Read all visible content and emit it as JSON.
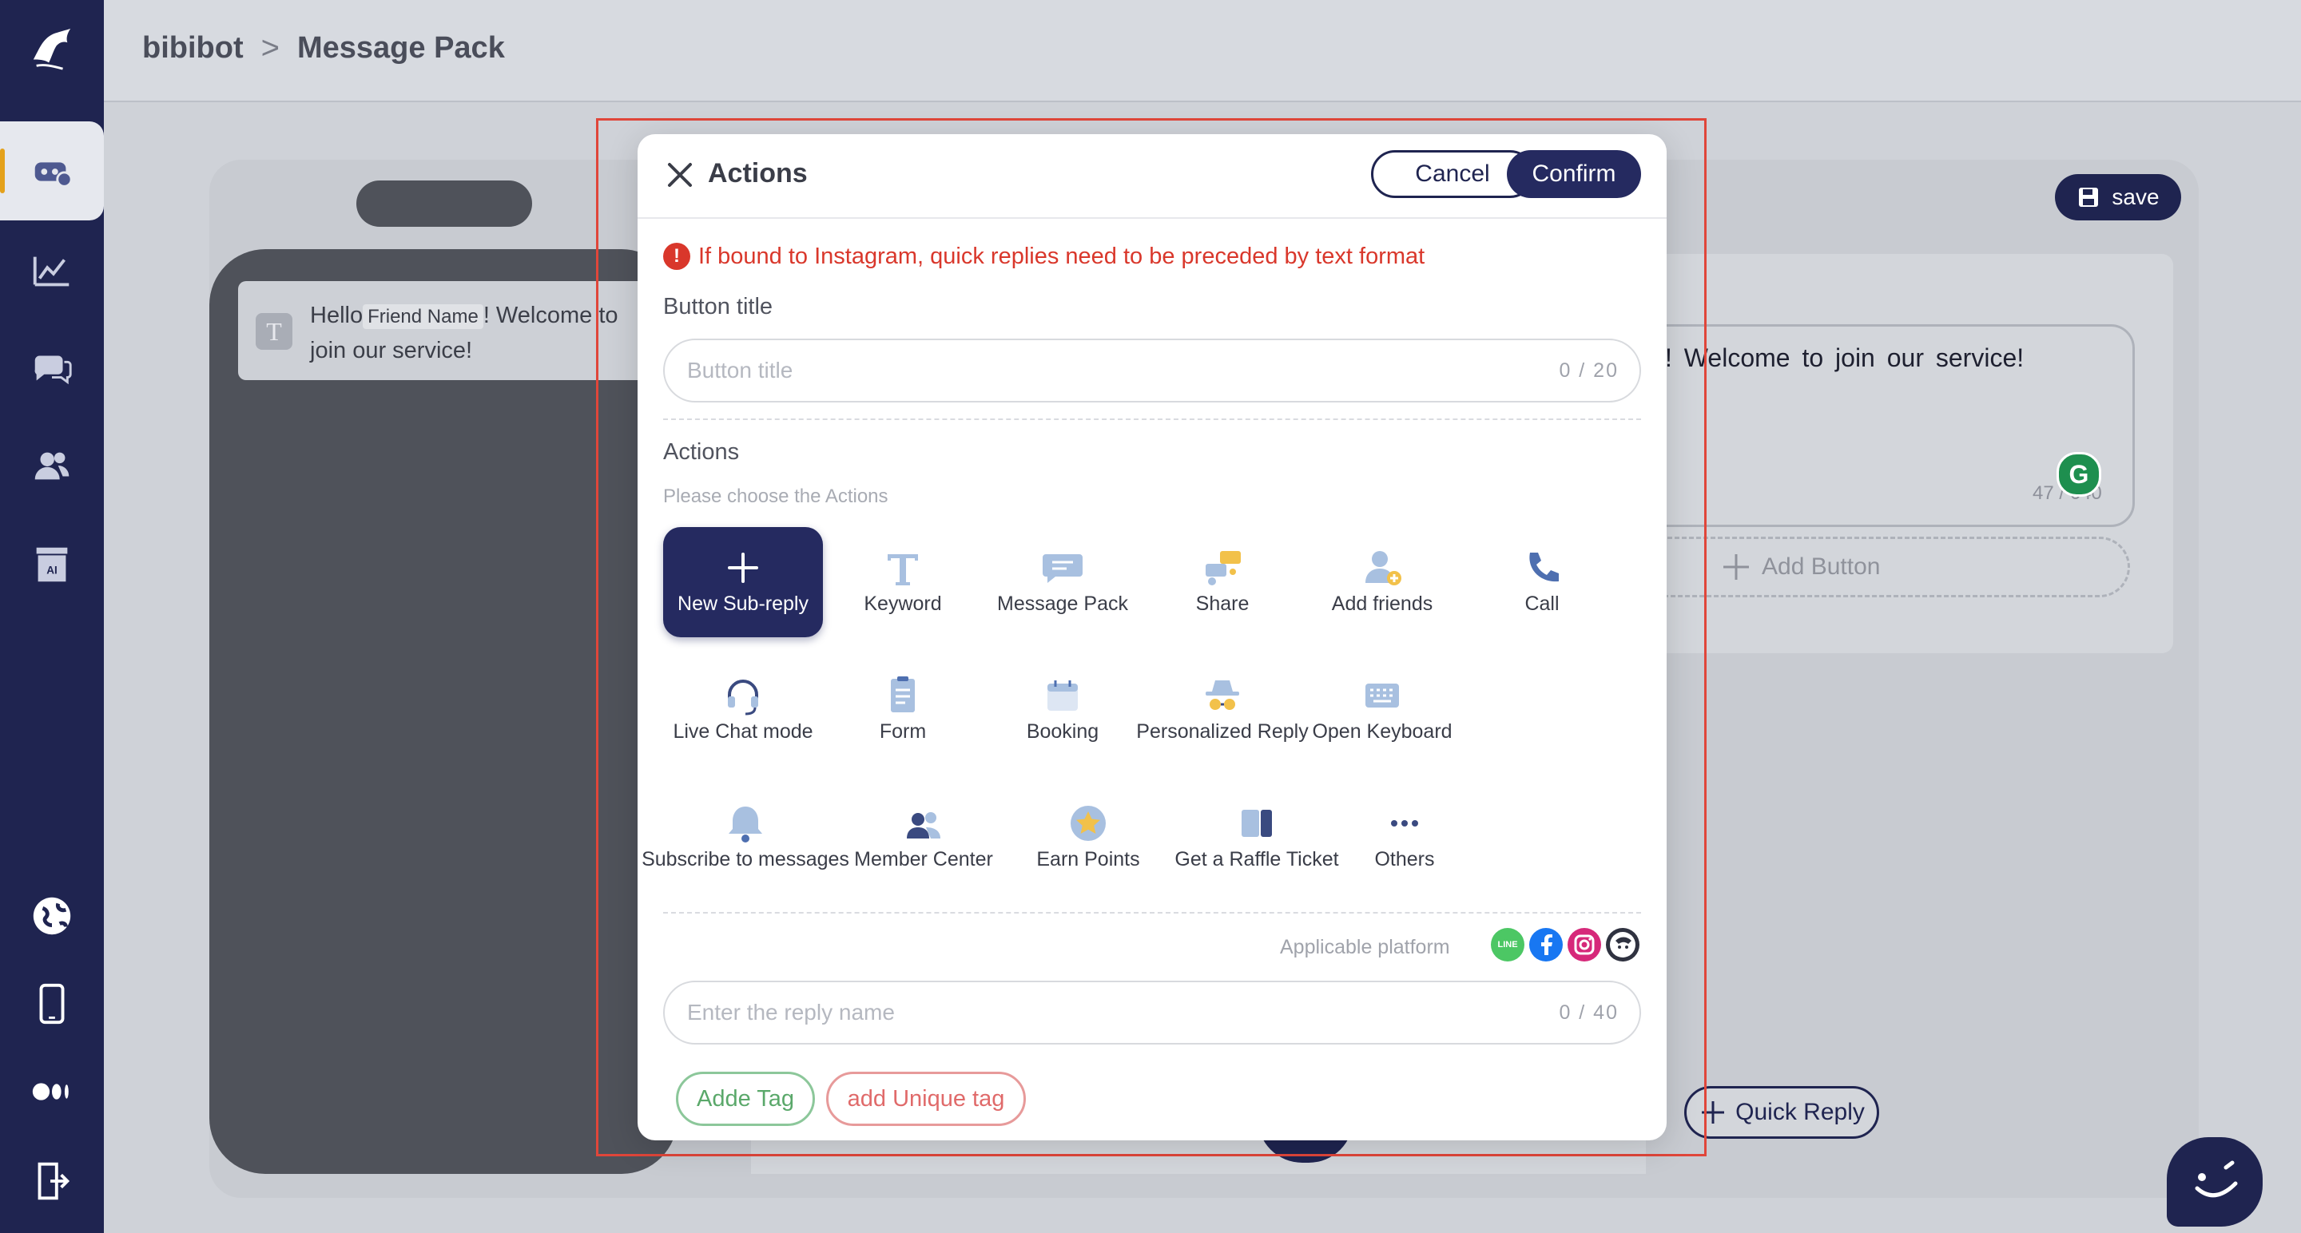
{
  "breadcrumb": {
    "root": "bibibot",
    "separator": ">",
    "current": "Message Pack"
  },
  "background": {
    "preview_text_1": "Hello",
    "preview_chip": "Friend Name",
    "preview_text_2": "! Welcome to join our service!",
    "avatar_letter": "T",
    "save_label": "save",
    "welcome_text": "! Welcome to join our service!",
    "counter": "47 / 640",
    "grammar_badge": "G",
    "add_button_label": "Add Button",
    "quick_reply_label": "Quick Reply"
  },
  "modal": {
    "title": "Actions",
    "cancel_label": "Cancel",
    "confirm_label": "Confirm",
    "warning": "If bound to Instagram, quick replies need to be preceded by text format",
    "warning_icon": "!",
    "button_title_label": "Button title",
    "button_title_placeholder": "Button title",
    "button_title_counter": "0 / 20",
    "actions_label": "Actions",
    "actions_hint": "Please choose the Actions",
    "actions": [
      {
        "label": "New Sub-reply",
        "icon": "plus-icon"
      },
      {
        "label": "Keyword",
        "icon": "text-t-icon"
      },
      {
        "label": "Message Pack",
        "icon": "message-icon"
      },
      {
        "label": "Share",
        "icon": "share-icon"
      },
      {
        "label": "Add friends",
        "icon": "add-friend-icon"
      },
      {
        "label": "Call",
        "icon": "phone-icon"
      },
      {
        "label": "Live Chat mode",
        "icon": "headset-icon"
      },
      {
        "label": "Form",
        "icon": "form-icon"
      },
      {
        "label": "Booking",
        "icon": "calendar-icon"
      },
      {
        "label": "Personalized Reply",
        "icon": "incognito-icon"
      },
      {
        "label": "Open Keyboard",
        "icon": "keyboard-icon"
      },
      {
        "label": "Subscribe to messages",
        "icon": "bell-icon"
      },
      {
        "label": "Member Center",
        "icon": "members-icon"
      },
      {
        "label": "Earn Points",
        "icon": "star-icon"
      },
      {
        "label": "Get a Raffle Ticket",
        "icon": "ticket-icon"
      },
      {
        "label": "Others",
        "icon": "more-icon"
      }
    ],
    "platform_label": "Applicable platform",
    "platform_line": "LINE",
    "reply_name_placeholder": "Enter the reply name",
    "reply_name_counter": "0 / 40",
    "add_tag_label": "Adde Tag",
    "add_unique_tag_label": "add Unique tag"
  },
  "colors": {
    "navy": "#1f2450",
    "accent_button": "#252a60",
    "warning_red": "#d9372b",
    "tag_green": "#5aa86a",
    "tag_red": "#e06a6a",
    "highlight_red": "#e0463a"
  }
}
